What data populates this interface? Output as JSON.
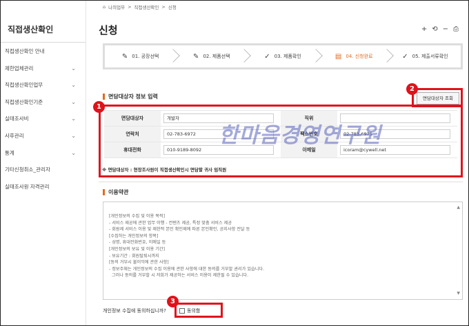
{
  "sidebar": {
    "title": "직접생산확인",
    "items": [
      {
        "label": "직접생산확인 안내",
        "chevron": false
      },
      {
        "label": "제한업체관리",
        "chevron": true
      },
      {
        "label": "직접생산확인업무",
        "chevron": true
      },
      {
        "label": "직접생산확인기준",
        "chevron": true
      },
      {
        "label": "실태조사비",
        "chevron": true
      },
      {
        "label": "사후관리",
        "chevron": true
      },
      {
        "label": "통계",
        "chevron": true
      },
      {
        "label": "기타신청취소_관리자",
        "chevron": false
      },
      {
        "label": "실태조사원 자격관리",
        "chevron": false
      }
    ]
  },
  "breadcrumb": {
    "home": "나의업무",
    "sep": ">",
    "level1": "직접생산확인",
    "level2": "신청"
  },
  "page_title": "신청",
  "toolbar": {
    "plus": "+",
    "undo": "⟲",
    "minus": "−",
    "print": "⎙"
  },
  "steps": [
    {
      "label": "01. 공장선택",
      "icon": "✎",
      "active": false
    },
    {
      "label": "02. 제품선택",
      "icon": "✎",
      "active": false
    },
    {
      "label": "03. 제품확인",
      "icon": "✓",
      "active": false
    },
    {
      "label": "04. 신청완료",
      "icon": "▤",
      "active": true
    },
    {
      "label": "05. 제출서류확인",
      "icon": "✓",
      "active": false
    }
  ],
  "interviewee": {
    "section_title": "면담대상자 정보 입력",
    "lookup_button": "면담대상자 조회",
    "rows": [
      {
        "l1": "면담대상자",
        "v1": "개발자",
        "l2": "직위",
        "v2": ""
      },
      {
        "l1": "연락처",
        "v1": "02-783-6972",
        "l2": "팩스번호",
        "v2": "02-783-6975"
      },
      {
        "l1": "휴대전화",
        "v1": "010-9189-8092",
        "l2": "이메일",
        "v2": "icoram@cywell.net"
      }
    ],
    "note": "※ 면담대상자 : 현장조사원이 직접생산확인시 면담할 귀사 임직원"
  },
  "watermark": "한마음경영연구원",
  "terms": {
    "section_title": "이용약관",
    "lines": [
      "[개인정보의 수집 및 이용 목적]",
      "- 서비스 제공에 관한 업무 이행 - 컨텐츠 제공, 특정 맞춤 서비스 제공",
      "- 회원제 서비스 이용 및 제한적 본인 확인제에 따른 본인확인, 공지사항 전달 등",
      "[수집하는 개인정보의 항목]",
      "- 성명, 휴대전화번호, 이메일 등",
      "[개인정보의 보유 및 이용 기간]",
      "- 보유기간 : 회원탈퇴시까지",
      "[동의 거부시 불이익에 관한 사항]",
      "- 정보주체는 개인정보의 수집 이용에 관한 사항에 대한 동의를 거부할 권리가 있습니다.",
      "  그러나 동의를 거부할 시 저희가 제공하는 서비스 이용이 제한될 수 있습니다."
    ],
    "agree_question": "개인정보 수집에 동의하십니까?",
    "agree_label": "동의함"
  },
  "annotations": {
    "b1": "1",
    "b2": "2",
    "b3": "3"
  }
}
